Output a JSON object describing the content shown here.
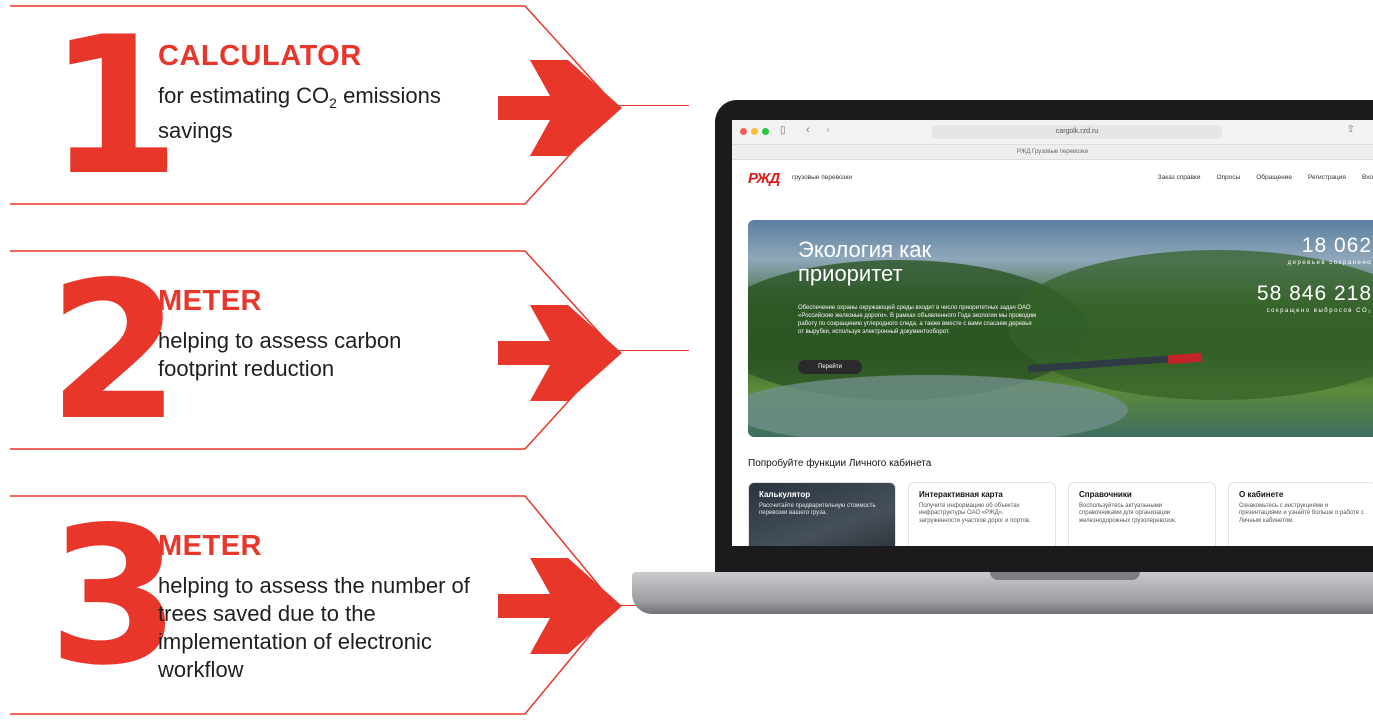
{
  "callouts": [
    {
      "number": "1",
      "title": "CALCULATOR",
      "desc_before_sub": "for estimating CO",
      "desc_sub": "2",
      "desc_after_sub": " emissions savings"
    },
    {
      "number": "2",
      "title": "METER",
      "desc": "helping to assess carbon footprint reduction"
    },
    {
      "number": "3",
      "title": "METER",
      "desc": "helping to assess the number of trees saved due to the implementation of electronic workflow"
    }
  ],
  "browser": {
    "url": "cargolk.rzd.ru",
    "tab_title": "РЖД Грузовые перевозки"
  },
  "site": {
    "logo": "РЖД",
    "brand_text": "грузовые перевозки",
    "nav": [
      "Заказ справки",
      "Опросы",
      "Обращение",
      "Регистрация",
      "Вхо"
    ]
  },
  "hero": {
    "title": "Экология как приоритет",
    "text": "Обеспечение охраны окружающей среды входит в число приоритетных задач ОАО «Российские железные дороги». В рамках объявленного Года экологии мы проводим работу по сокращению углеродного следа, а также вместе с вами спасаем деревья от вырубки, используя электронный документооборот.",
    "button": "Перейти",
    "stats": [
      {
        "value": "18 062",
        "label": "деревьев сохранено"
      },
      {
        "value": "58 846 218",
        "label": "сокращено выбросов CO₂"
      }
    ]
  },
  "section_title": "Попробуйте функции Личного кабинета",
  "cards": [
    {
      "title": "Калькулятор",
      "text": "Рассчитайте предварительную стоимость перевозки вашего груза."
    },
    {
      "title": "Интерактивная карта",
      "text": "Получите информацию об объектах инфраструктуры ОАО «РЖД», загруженности участков дорог и портов."
    },
    {
      "title": "Справочники",
      "text": "Воспользуйтесь актуальными справочниками для организации железнодорожных грузоперевозок."
    },
    {
      "title": "О кабинете",
      "text": "Ознакомьтесь с инструкциями и презентациями и узнайте больше о работе с Личным кабинетом."
    }
  ],
  "colors": {
    "accent": "#e8362b",
    "laptop": "#1b1b1d"
  }
}
